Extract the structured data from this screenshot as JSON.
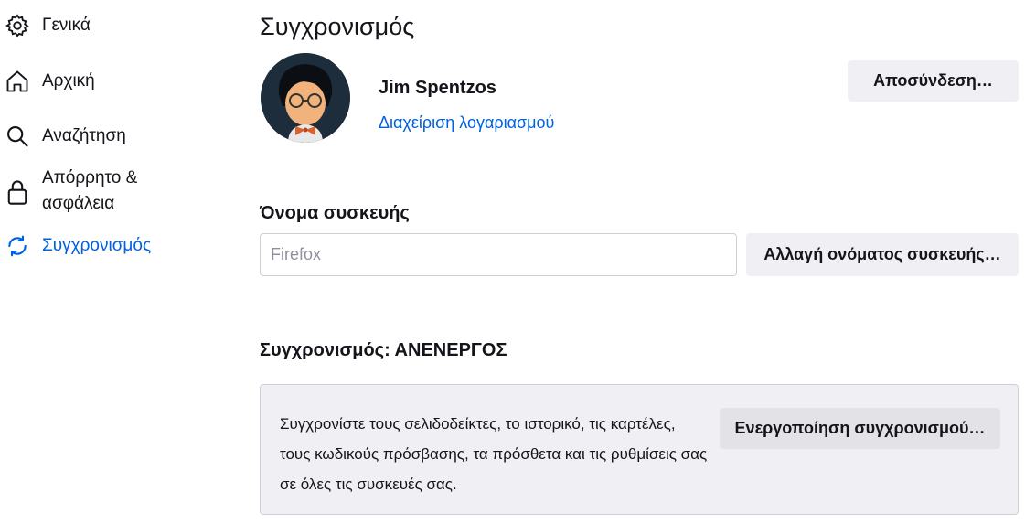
{
  "sidebar": {
    "items": [
      {
        "label": "Γενικά",
        "icon": "gear-icon",
        "selected": false
      },
      {
        "label": "Αρχική",
        "icon": "home-icon",
        "selected": false
      },
      {
        "label": "Αναζήτηση",
        "icon": "search-icon",
        "selected": false
      },
      {
        "label": "Απόρρητο & ασφάλεια",
        "icon": "lock-icon",
        "selected": false
      },
      {
        "label": "Συγχρονισμός",
        "icon": "sync-icon",
        "selected": true
      }
    ]
  },
  "main": {
    "title": "Συγχρονισμός",
    "account": {
      "name": "Jim Spentzos",
      "manage_link": "Διαχείριση λογαριασμού",
      "signout_label": "Αποσύνδεση…"
    },
    "device": {
      "heading": "Όνομα συσκευής",
      "placeholder": "Firefox",
      "rename_label": "Αλλαγή ονόματος συσκευής…"
    },
    "sync": {
      "heading": "Συγχρονισμός: ΑΝΕΝΕΡΓΟΣ",
      "description": "Συγχρονίστε τους σελιδοδείκτες, το ιστορικό, τις καρτέλες, τους κωδικούς πρόσβασης, τα πρόσθετα και τις ρυθμίσεις σας σε όλες τις συσκευές σας.",
      "enable_label": "Ενεργοποίηση συγχρονισμού…"
    }
  },
  "colors": {
    "accent": "#0061e0",
    "button_bg": "#f0f0f4",
    "text": "#15141a"
  }
}
